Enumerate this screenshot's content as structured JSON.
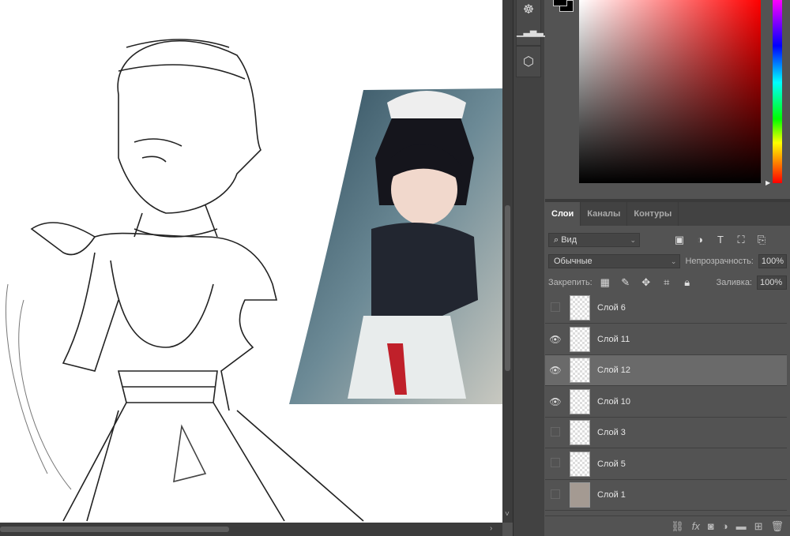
{
  "toolstrip": {
    "icons": [
      "navigator-wheel-icon",
      "histogram-icon",
      "3d-cube-icon"
    ]
  },
  "color": {
    "foreground": "#000000",
    "background": "#000000",
    "hue": "#ff0000"
  },
  "layers_panel": {
    "tabs": [
      {
        "label": "Слои",
        "active": true
      },
      {
        "label": "Каналы"
      },
      {
        "label": "Контуры"
      }
    ],
    "filter": {
      "label": "Вид"
    },
    "blend_mode": "Обычные",
    "opacity_label": "Непрозрачность:",
    "opacity": "100%",
    "lock_label": "Закрепить:",
    "fill_label": "Заливка:",
    "fill": "100%",
    "layers": [
      {
        "name": "Слой 6",
        "visible": false,
        "selected": false
      },
      {
        "name": "Слой 11",
        "visible": true,
        "selected": false
      },
      {
        "name": "Слой 12",
        "visible": true,
        "selected": true
      },
      {
        "name": "Слой 10",
        "visible": true,
        "selected": false
      },
      {
        "name": "Слой 3",
        "visible": false,
        "selected": false
      },
      {
        "name": "Слой 5",
        "visible": false,
        "selected": false
      },
      {
        "name": "Слой 1",
        "visible": false,
        "selected": false,
        "texture": true
      }
    ]
  }
}
